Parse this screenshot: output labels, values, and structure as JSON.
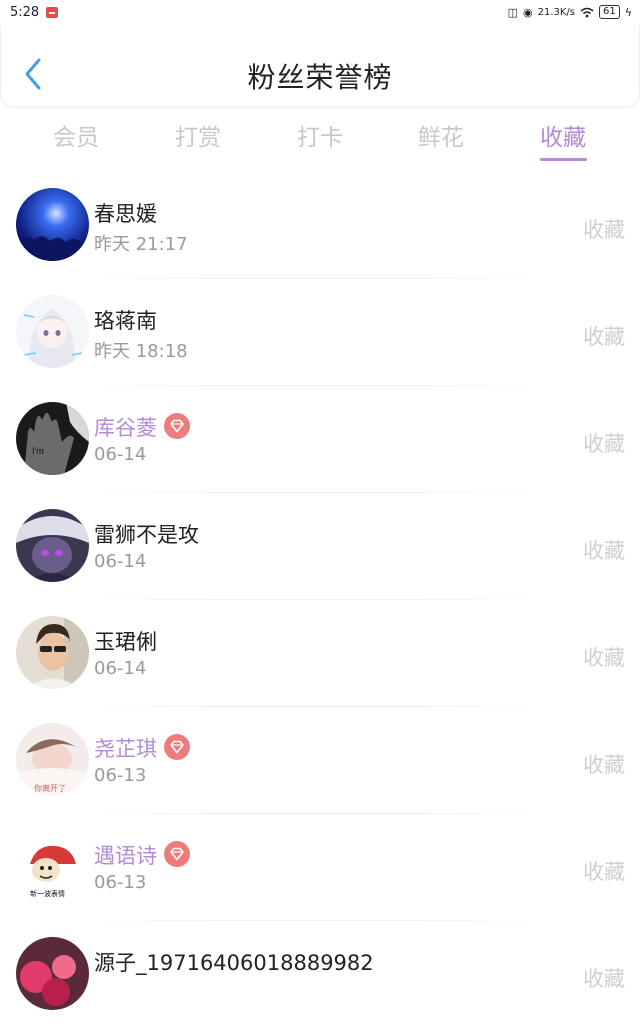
{
  "status_bar": {
    "time": "5:28",
    "speed": "21.3K/s",
    "battery": "61"
  },
  "header": {
    "title": "粉丝荣誉榜"
  },
  "tabs": [
    {
      "label": "会员",
      "active": false
    },
    {
      "label": "打赏",
      "active": false
    },
    {
      "label": "打卡",
      "active": false
    },
    {
      "label": "鲜花",
      "active": false
    },
    {
      "label": "收藏",
      "active": true
    }
  ],
  "colors": {
    "accent": "#b38ad8",
    "vip_badge": "#ee7c7c",
    "muted": "#9a9a9a",
    "action": "#cfcfcf"
  },
  "fans": [
    {
      "name": "春思媛",
      "time": "昨天 21:17",
      "action": "收藏",
      "vip": false
    },
    {
      "name": "珞蒋南",
      "time": "昨天 18:18",
      "action": "收藏",
      "vip": false
    },
    {
      "name": "库谷菱",
      "time": "06-14",
      "action": "收藏",
      "vip": true
    },
    {
      "name": "雷狮不是攻",
      "time": "06-14",
      "action": "收藏",
      "vip": false
    },
    {
      "name": "玉珺俐",
      "time": "06-14",
      "action": "收藏",
      "vip": false
    },
    {
      "name": "尧芷琪",
      "time": "06-13",
      "action": "收藏",
      "vip": true
    },
    {
      "name": "遇语诗",
      "time": "06-13",
      "action": "收藏",
      "vip": true
    },
    {
      "name": "源子_19716406018889982",
      "time": "",
      "action": "收藏",
      "vip": false
    }
  ]
}
